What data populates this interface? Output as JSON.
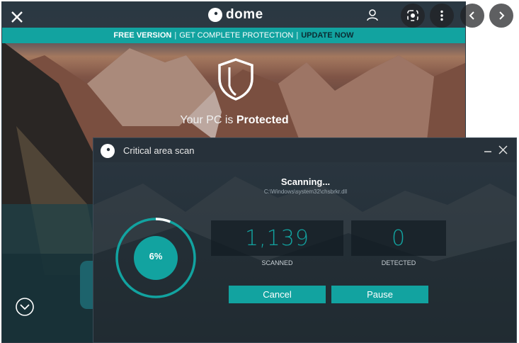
{
  "app": {
    "logo_text": "dome",
    "banner": {
      "free": "FREE VERSION",
      "separator": "|",
      "get": "GET COMPLETE PROTECTION",
      "update": "UPDATE NOW"
    },
    "status_prefix": "Your PC is",
    "status_strong": "Protected"
  },
  "dialog": {
    "title": "Critical area scan",
    "scanning": "Scanning...",
    "path": "C:\\Windows\\system32\\chsbrkr.dll",
    "progress_label": "6%",
    "progress_fraction": 0.06,
    "scanned_value": "1,139",
    "scanned_label": "SCANNED",
    "detected_value": "0",
    "detected_label": "DETECTED",
    "cancel_label": "Cancel",
    "pause_label": "Pause"
  },
  "colors": {
    "accent": "#12a3a0",
    "titlebar": "#27313a"
  },
  "icons": [
    "close-icon",
    "user-icon",
    "shield-icon",
    "chevron-down-icon",
    "lens-icon",
    "more-icon",
    "chevron-left-icon",
    "chevron-right-icon",
    "minimize-icon"
  ]
}
